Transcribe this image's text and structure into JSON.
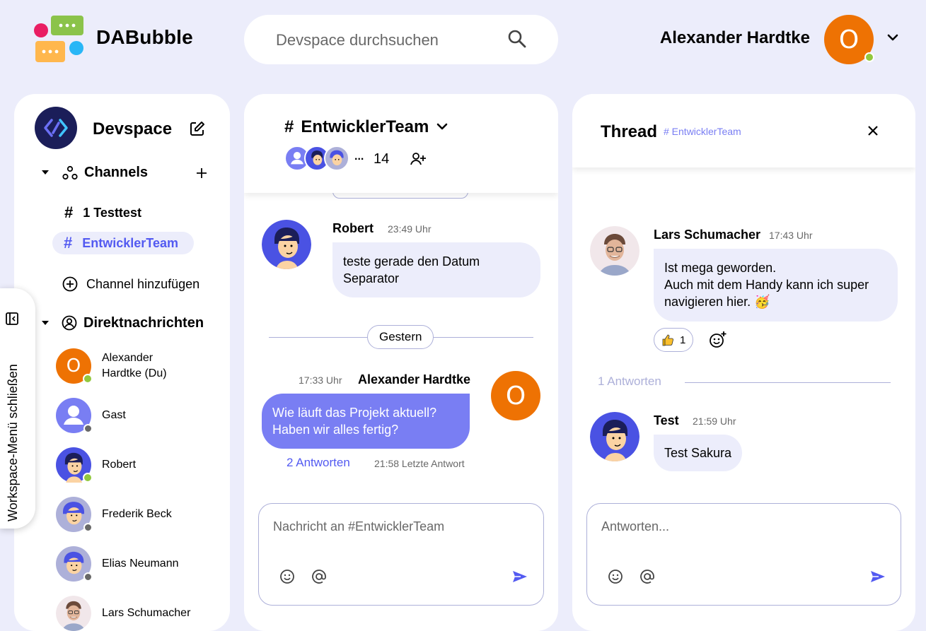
{
  "header": {
    "brand": "DABubble",
    "search_placeholder": "Devspace durchsuchen",
    "user_name": "Alexander Hardtke",
    "user_initial": "O"
  },
  "sidebar": {
    "workspace_name": "Devspace",
    "channels_title": "Channels",
    "channels": [
      {
        "hash": "#",
        "label": "1 Testtest"
      },
      {
        "hash": "#",
        "label": "EntwicklerTeam"
      }
    ],
    "add_channel_label": "Channel hinzufügen",
    "dm_title": "Direktnachrichten",
    "dms": [
      {
        "name": "Alexander Hardtke (Du)",
        "status": "online"
      },
      {
        "name": "Gast",
        "status": "offline"
      },
      {
        "name": "Robert",
        "status": "online"
      },
      {
        "name": "Frederik Beck",
        "status": "offline"
      },
      {
        "name": "Elias Neumann",
        "status": "offline"
      },
      {
        "name": "Lars Schumacher",
        "status": "offline"
      }
    ],
    "toggle_label": "Workspace-Menü schließen"
  },
  "chat": {
    "channel_name": "EntwicklerTeam",
    "member_ellipsis": "...",
    "member_count": "14",
    "messages": [
      {
        "name": "Robert",
        "time": "23:49 Uhr",
        "text": "teste gerade den Datum Separator"
      },
      {
        "name": "Alexander Hardtke",
        "time": "17:33 Uhr",
        "text": "Wie läuft das Projekt aktuell? Haben wir alles fertig?",
        "replies": "2 Antworten",
        "last_reply": "21:58 Letzte Antwort"
      }
    ],
    "separator_label": "Gestern",
    "input_placeholder": "Nachricht an #EntwicklerTeam"
  },
  "thread": {
    "title": "Thread",
    "channel": "# EntwicklerTeam",
    "root": {
      "name": "Lars Schumacher",
      "time": "17:43 Uhr",
      "line1": "Ist mega geworden.",
      "line2": "Auch mit dem Handy kann ich super",
      "line3": "navigieren hier. 🥳",
      "reaction_count": "1"
    },
    "replies_label": "1 Antworten",
    "reply": {
      "name": "Test",
      "time": "21:59 Uhr",
      "text": "Test Sakura"
    },
    "input_placeholder": "Antworten..."
  },
  "colors": {
    "accent": "#535af1",
    "bubble_out": "#797ef3",
    "background": "#ecedfb",
    "avatar_orange": "#ee7203",
    "online": "#92c83e"
  }
}
